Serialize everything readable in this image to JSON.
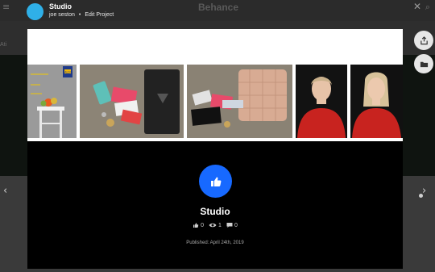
{
  "background": {
    "menu_icon": "≡",
    "logo": "Behance",
    "search_icon": "⌕",
    "band_text": "Ati",
    "arrow_left": "‹",
    "arrow_right": "›"
  },
  "header": {
    "project_title": "Studio",
    "owner": "joe seston",
    "separator": "•",
    "edit_link": "Edit Project",
    "close_icon": "✕"
  },
  "side_actions": [
    {
      "name": "share-icon"
    },
    {
      "name": "folder-icon"
    }
  ],
  "thumbnails": [
    {
      "name": "thumb-stool-fruit",
      "text": "ALDI"
    },
    {
      "name": "thumb-wallet-black"
    },
    {
      "name": "thumb-wallet-pink"
    },
    {
      "name": "thumb-portrait-1"
    },
    {
      "name": "thumb-portrait-2"
    }
  ],
  "project": {
    "title": "Studio",
    "likes": "0",
    "views": "1",
    "comments": "0",
    "published": "Published: April 24th, 2019"
  },
  "colors": {
    "accent": "#1769ff",
    "avatar": "#2fb0e8"
  }
}
